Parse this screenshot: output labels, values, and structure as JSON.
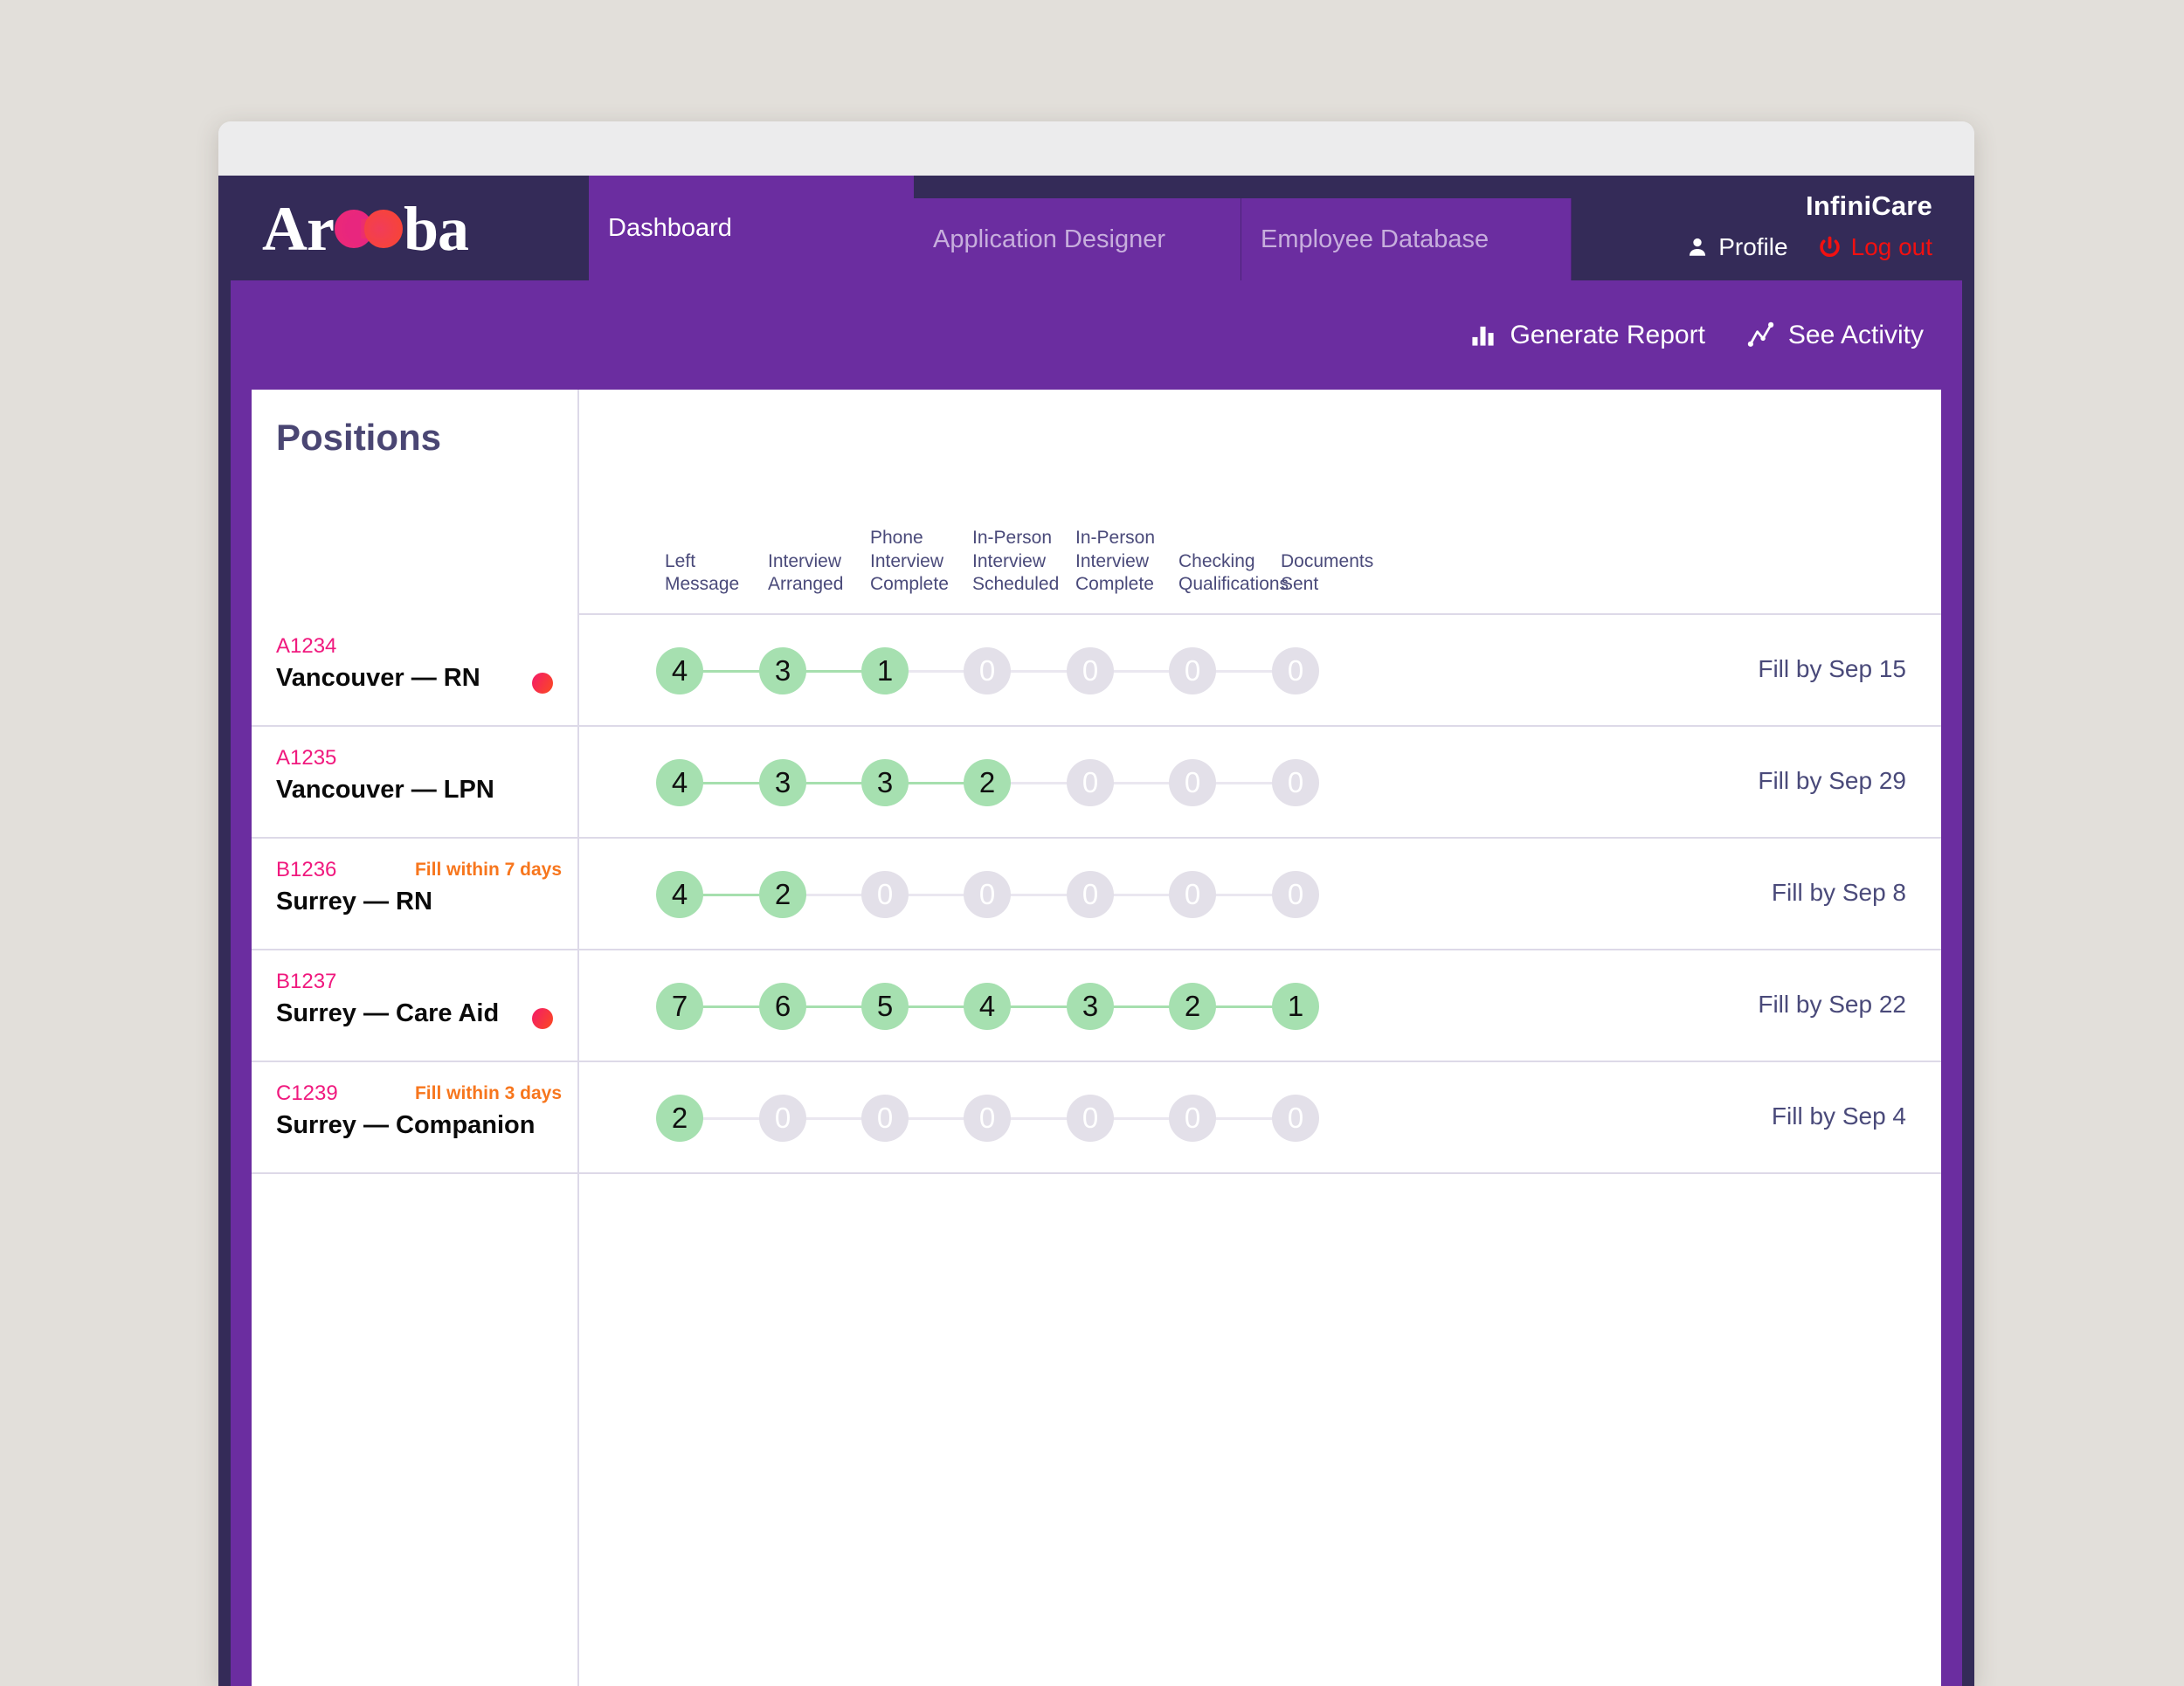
{
  "window": {
    "chrome_label": ""
  },
  "nav": {
    "logo": {
      "pre": "Ar",
      "post": "ba",
      "icon": "double-dot-logo-icon"
    },
    "tabs": [
      {
        "label": "Dashboard",
        "active": true
      },
      {
        "label": "Application Designer",
        "active": false
      },
      {
        "label": "Employee Database",
        "active": false
      }
    ],
    "account": {
      "brand": "InfiniCare",
      "profile_label": "Profile",
      "profile_icon": "person-icon",
      "logout_label": "Log out",
      "logout_icon": "power-icon",
      "logout_color": "#f21010"
    }
  },
  "toolbar": {
    "generate_report_label": "Generate Report",
    "generate_report_icon": "bar-chart-icon",
    "see_activity_label": "See Activity",
    "see_activity_icon": "line-chart-icon"
  },
  "board": {
    "title": "Positions",
    "stage_headers": [
      "Left\nMessage",
      "Interview\nArranged",
      "Phone\nInterview\nComplete",
      "In-Person\nInterview\nScheduled",
      "In-Person\nInterview\nComplete",
      "Checking\nQualifications",
      "Documents\nSent"
    ],
    "colors": {
      "accent_purple": "#6b2da0",
      "nav_purple": "#342b58",
      "id_pink": "#f0197e",
      "warning_orange": "#f7761d",
      "stage_green": "#a6e0b0",
      "stage_grey": "#e3e0e9",
      "text_slate": "#4a4a7a"
    },
    "rows": [
      {
        "id": "A1234",
        "title": "Vancouver — RN",
        "warning": "",
        "flag": true,
        "counts": [
          4,
          3,
          1,
          0,
          0,
          0,
          0
        ],
        "deadline": "Fill by Sep 15"
      },
      {
        "id": "A1235",
        "title": "Vancouver — LPN",
        "warning": "",
        "flag": false,
        "counts": [
          4,
          3,
          3,
          2,
          0,
          0,
          0
        ],
        "deadline": "Fill by Sep 29"
      },
      {
        "id": "B1236",
        "title": "Surrey — RN",
        "warning": "Fill within 7 days",
        "flag": false,
        "counts": [
          4,
          2,
          0,
          0,
          0,
          0,
          0
        ],
        "deadline": "Fill by Sep 8"
      },
      {
        "id": "B1237",
        "title": "Surrey — Care Aid",
        "warning": "",
        "flag": true,
        "counts": [
          7,
          6,
          5,
          4,
          3,
          2,
          1
        ],
        "deadline": "Fill by Sep 22"
      },
      {
        "id": "C1239",
        "title": "Surrey — Companion",
        "warning": "Fill within 3 days",
        "flag": false,
        "counts": [
          2,
          0,
          0,
          0,
          0,
          0,
          0
        ],
        "deadline": "Fill by Sep 4"
      }
    ]
  }
}
